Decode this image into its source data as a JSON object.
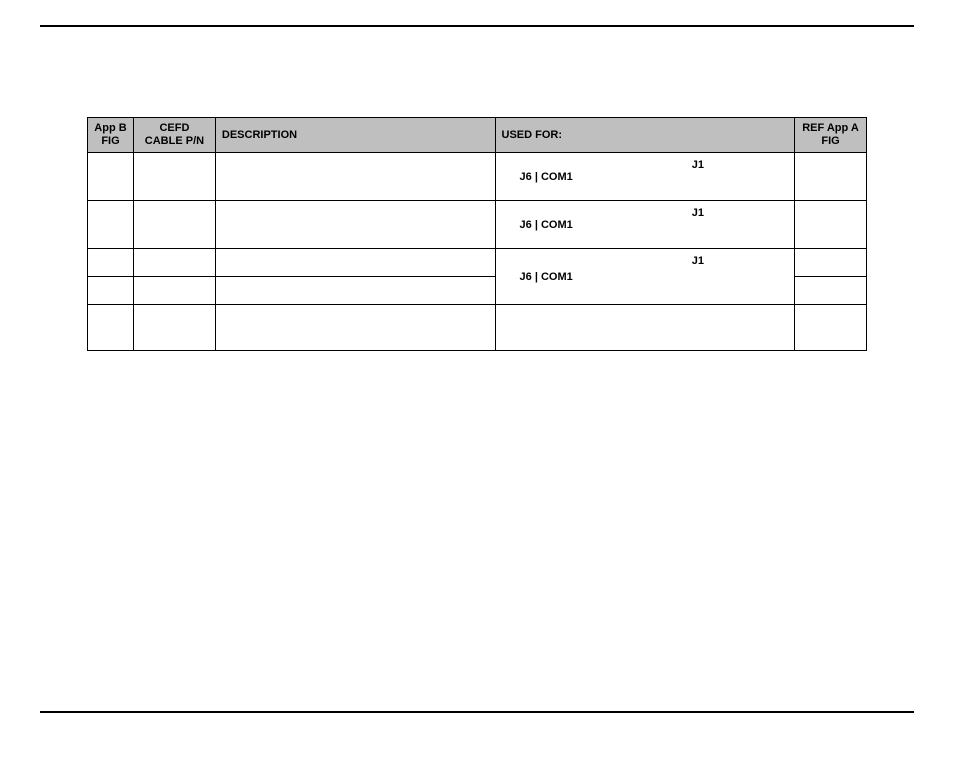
{
  "table": {
    "headers": {
      "appb": "App B\nFIG",
      "cefd": "CEFD\nCABLE P/N",
      "desc": "DESCRIPTION",
      "used": "USED FOR:",
      "refa": "REF App A\nFIG"
    },
    "rows": [
      {
        "used_left": "J6 | COM1",
        "used_right": "J1",
        "rowspan_used": 1,
        "short": false
      },
      {
        "used_left": "J6 | COM1",
        "used_right": "J1",
        "rowspan_used": 1,
        "short": false
      },
      {
        "used_left": "J6 | COM1",
        "used_right": "J1",
        "rowspan_used": 2,
        "short": true
      },
      {
        "short": true
      },
      {
        "used_left": "",
        "used_right": "",
        "rowspan_used": 1,
        "short": false
      }
    ]
  }
}
